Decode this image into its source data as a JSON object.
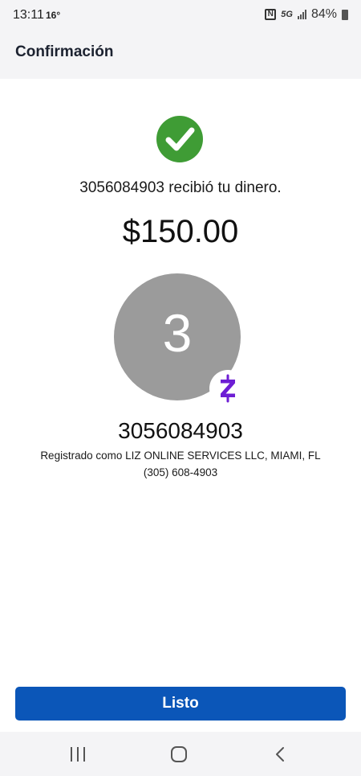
{
  "status_bar": {
    "time": "13:11",
    "temperature": "16°",
    "network": "5G",
    "battery": "84%"
  },
  "header": {
    "title": "Confirmación"
  },
  "confirmation": {
    "message": "3056084903 recibió tu dinero.",
    "amount": "$150.00",
    "success_icon": "check-circle-icon",
    "success_color": "#3f9c35"
  },
  "recipient": {
    "avatar_initial": "3",
    "avatar_color": "#9b9b9b",
    "badge_icon": "zelle-logo-icon",
    "badge_color": "#6d1ed4",
    "name": "3056084903",
    "registered_as": "Registrado como LIZ ONLINE SERVICES LLC, MIAMI, FL",
    "phone": "(305) 608-4903"
  },
  "actions": {
    "done_label": "Listo",
    "done_color": "#0b56b8"
  },
  "nav_bar": {
    "recents_icon": "recents-icon",
    "home_icon": "home-icon",
    "back_icon": "back-chevron-icon"
  }
}
